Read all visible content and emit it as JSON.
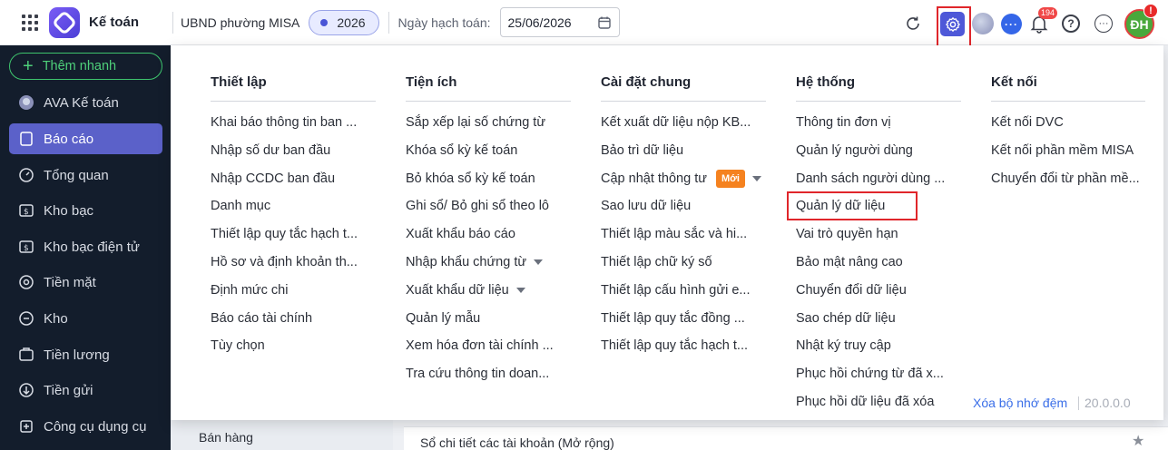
{
  "header": {
    "app_title": "Kế toán",
    "org_name": "UBND phường MISA",
    "year": "2026",
    "date_label": "Ngày hạch toán:",
    "date_value": "25/06/2026",
    "notification_count": "194",
    "user_initials": "ĐH",
    "user_alert": "!"
  },
  "sidebar": {
    "quick_add": "Thêm nhanh",
    "items": [
      {
        "label": "AVA Kế toán",
        "icon": "ava-icon"
      },
      {
        "label": "Báo cáo",
        "icon": "report-icon",
        "active": true
      },
      {
        "label": "Tổng quan",
        "icon": "overview-icon"
      },
      {
        "label": "Kho bạc",
        "icon": "treasury-icon"
      },
      {
        "label": "Kho bạc điện tử",
        "icon": "e-treasury-icon"
      },
      {
        "label": "Tiền mặt",
        "icon": "cash-icon"
      },
      {
        "label": "Kho",
        "icon": "warehouse-icon"
      },
      {
        "label": "Tiền lương",
        "icon": "salary-icon"
      },
      {
        "label": "Tiền gửi",
        "icon": "deposit-icon"
      },
      {
        "label": "Công cụ dụng cụ",
        "icon": "tools-icon"
      }
    ]
  },
  "menu": {
    "columns": [
      {
        "title": "Thiết lập",
        "items": [
          {
            "label": "Khai báo thông tin ban ..."
          },
          {
            "label": "Nhập số dư ban đầu"
          },
          {
            "label": "Nhập CCDC ban đầu"
          },
          {
            "label": "Danh mục"
          },
          {
            "label": "Thiết lập quy tắc hạch t..."
          },
          {
            "label": "Hồ sơ và định khoản th..."
          },
          {
            "label": "Định mức chi"
          },
          {
            "label": "Báo cáo tài chính"
          },
          {
            "label": "Tùy chọn"
          }
        ]
      },
      {
        "title": "Tiện ích",
        "items": [
          {
            "label": "Sắp xếp lại số chứng từ"
          },
          {
            "label": "Khóa sổ kỳ kế toán"
          },
          {
            "label": "Bỏ khóa sổ kỳ kế toán"
          },
          {
            "label": "Ghi sổ/ Bỏ ghi sổ theo lô"
          },
          {
            "label": "Xuất khẩu báo cáo"
          },
          {
            "label": "Nhập khẩu chứng từ",
            "caret": true
          },
          {
            "label": "Xuất khẩu dữ liệu",
            "caret": true
          },
          {
            "label": "Quản lý mẫu"
          },
          {
            "label": "Xem hóa đơn tài chính ..."
          },
          {
            "label": "Tra cứu thông tin doan..."
          }
        ]
      },
      {
        "title": "Cài đặt chung",
        "items": [
          {
            "label": "Kết xuất dữ liệu nộp KB..."
          },
          {
            "label": "Bảo trì dữ liệu"
          },
          {
            "label": "Cập nhật thông tư",
            "badge": "Mới",
            "caret": true
          },
          {
            "label": "Sao lưu dữ liệu"
          },
          {
            "label": "Thiết lập màu sắc và hi..."
          },
          {
            "label": "Thiết lập chữ ký số"
          },
          {
            "label": "Thiết lập cấu hình gửi e..."
          },
          {
            "label": "Thiết lập quy tắc đồng ..."
          },
          {
            "label": "Thiết lập quy tắc hạch t..."
          }
        ]
      },
      {
        "title": "Hệ thống",
        "items": [
          {
            "label": "Thông tin đơn vị"
          },
          {
            "label": "Quản lý người dùng"
          },
          {
            "label": "Danh sách người dùng ..."
          },
          {
            "label": "Quản lý dữ liệu"
          },
          {
            "label": "Vai trò quyền hạn"
          },
          {
            "label": "Bảo mật nâng cao"
          },
          {
            "label": "Chuyển đổi dữ liệu"
          },
          {
            "label": "Sao chép dữ liệu"
          },
          {
            "label": "Nhật ký truy cập"
          },
          {
            "label": "Phục hồi chứng từ đã x..."
          },
          {
            "label": "Phục hồi dữ liệu đã xóa"
          }
        ]
      },
      {
        "title": "Kết nối",
        "items": [
          {
            "label": "Kết nối DVC"
          },
          {
            "label": "Kết nối phần mềm MISA"
          },
          {
            "label": "Chuyển đổi từ phần mề..."
          }
        ]
      }
    ],
    "clear_cache": "Xóa bộ nhớ đệm",
    "version": "20.0.0.0"
  },
  "background": {
    "left_item": "Bán hàng",
    "right_item": "Sổ chi tiết các tài khoản (Mở rộng)"
  },
  "colors": {
    "sidebar_bg": "#131d2c",
    "accent": "#5b61c9",
    "highlight": "#e0262b",
    "link": "#3a6ee8"
  }
}
